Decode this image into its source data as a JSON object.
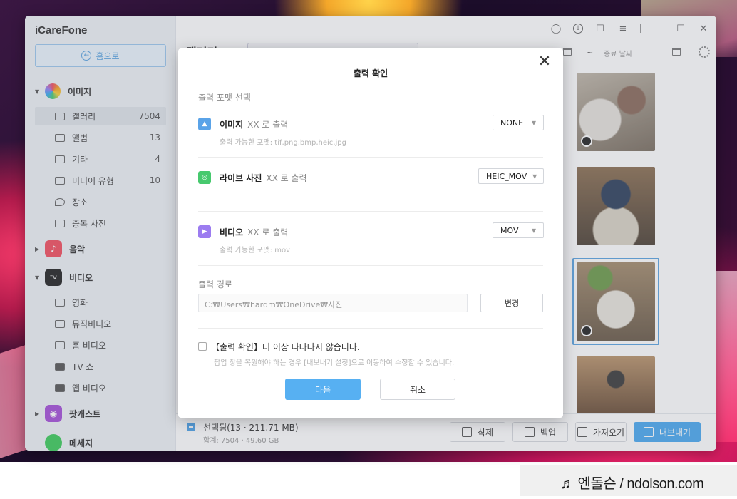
{
  "app": {
    "title": "iCareFone"
  },
  "sidebar": {
    "home_label": "홈으로",
    "categories": [
      {
        "label": "이미지",
        "icon": "photos-icon",
        "color": "#f5a623"
      },
      {
        "label": "음악",
        "icon": "music-icon",
        "color": "#f24d5e"
      },
      {
        "label": "비디오",
        "icon": "appletv-icon",
        "color": "#222222",
        "icon_text": "tv"
      },
      {
        "label": "팟캐스트",
        "icon": "podcast-icon",
        "color": "#a54fd8"
      },
      {
        "label": "메세지",
        "icon": "message-icon",
        "color": "#3ccb5a"
      }
    ],
    "image_items": [
      {
        "label": "갤러리",
        "count": "7504"
      },
      {
        "label": "앨범",
        "count": "13"
      },
      {
        "label": "기타",
        "count": "4"
      },
      {
        "label": "미디어 유형",
        "count": "10"
      },
      {
        "label": "장소",
        "count": ""
      },
      {
        "label": "중복 사진",
        "count": ""
      }
    ],
    "video_items": [
      {
        "label": "영화"
      },
      {
        "label": "뮤직비디오"
      },
      {
        "label": "홈 비디오"
      },
      {
        "label": "TV 쇼"
      },
      {
        "label": "앱 비디오"
      }
    ]
  },
  "main": {
    "page_title": "갤러리",
    "end_date_placeholder": "종료 날짜",
    "date_separator": "~"
  },
  "bottom_bar": {
    "selected_text": "선택됨(13 · 211.71 MB)",
    "total_text": "합계: 7504 · 49.60 GB",
    "delete_label": "삭제",
    "backup_label": "백업",
    "import_label": "가져오기",
    "export_label": "내보내기",
    "accent_color": "#4aa8f0"
  },
  "modal": {
    "title": "출력 확인",
    "format_section_label": "출력 포맷 선택",
    "rows": [
      {
        "name": "이미지",
        "output": "XX 로 출력",
        "hint": "출력 가능한 포맷: tif,png,bmp,heic,jpg",
        "format": "NONE",
        "icon": "image-icon",
        "color": "#5aa3e8"
      },
      {
        "name": "라이브 사진",
        "output": "XX 로 출력",
        "hint": "",
        "format": "HEIC_MOV",
        "icon": "live-photo-icon",
        "color": "#47c96e"
      },
      {
        "name": "비디오",
        "output": "XX 로 출력",
        "hint": "출력 가능한 포맷: mov",
        "format": "MOV",
        "icon": "video-play-icon",
        "color": "#9c7cf0"
      }
    ],
    "path_section_label": "출력 경로",
    "path_value": "C:₩Users₩hardm₩OneDrive₩사진",
    "change_label": "변경",
    "dont_show_label": "【출력 확인】더 이상 나타나지 않습니다.",
    "dont_show_hint": "팝업 창을 복원해야 하는 경우 [내보내기 설정]으로 이동하여 수정할 수 있습니다.",
    "next_label": "다음",
    "cancel_label": "취소"
  },
  "watermark": {
    "text": "♬ 엔돌슨 / ndolson.com"
  }
}
